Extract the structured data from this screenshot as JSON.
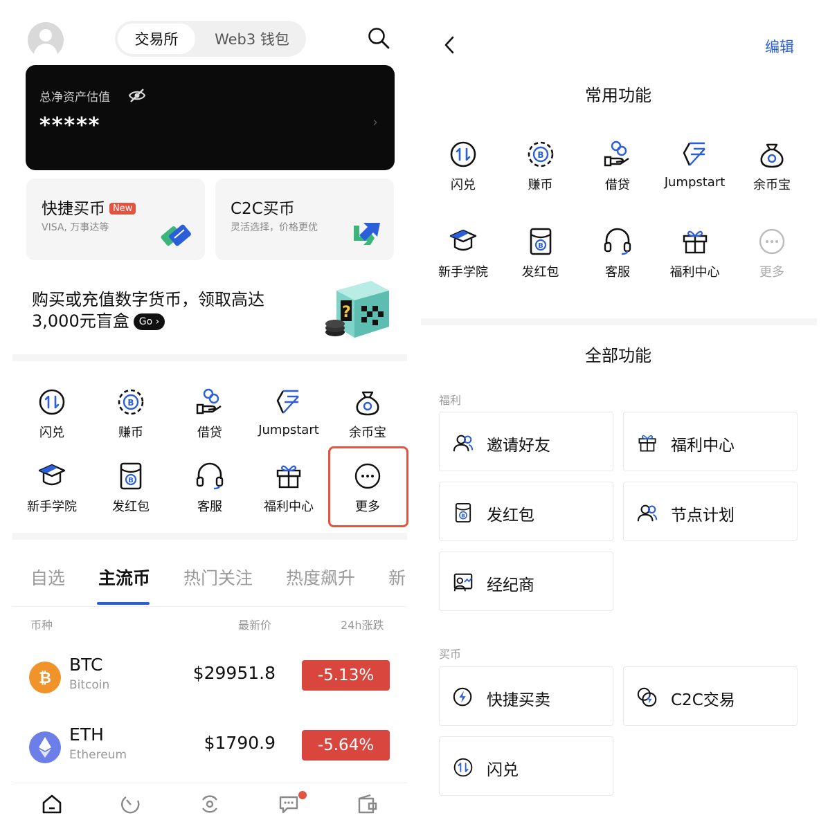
{
  "left": {
    "segment": {
      "active": "交易所",
      "inactive": "Web3 钱包"
    },
    "icons": {
      "avatar": "avatar-icon",
      "search": "search-icon"
    },
    "asset": {
      "label": "总净资产估值",
      "value": "*****",
      "eye_icon": "eye-off-icon"
    },
    "buy_cards": [
      {
        "title": "快捷买币",
        "badge": "New",
        "subtitle": "VISA, 万事达等",
        "icon": "cards-icon"
      },
      {
        "title": "C2C买币",
        "subtitle": "灵活选择，价格更优",
        "icon": "exchange-arrows-icon"
      }
    ],
    "promo": {
      "line1": "购买或充值数字货币，领取高达",
      "line2": "3,000元盲盒",
      "go": "Go"
    },
    "functions": [
      {
        "name": "闪兑",
        "icon": "swap-icon"
      },
      {
        "name": "赚币",
        "icon": "earn-coin-icon"
      },
      {
        "name": "借贷",
        "icon": "loan-icon"
      },
      {
        "name": "Jumpstart",
        "icon": "jumpstart-icon"
      },
      {
        "name": "余币宝",
        "icon": "money-bag-icon"
      },
      {
        "name": "新手学院",
        "icon": "graduation-cap-icon"
      },
      {
        "name": "发红包",
        "icon": "red-packet-icon"
      },
      {
        "name": "客服",
        "icon": "headset-icon"
      },
      {
        "name": "福利中心",
        "icon": "gift-icon"
      },
      {
        "name": "更多",
        "icon": "more-icon"
      }
    ],
    "market_tabs": [
      "自选",
      "主流币",
      "热门关注",
      "热度飙升",
      "新"
    ],
    "market_active": "主流币",
    "table_header": {
      "coin": "币种",
      "price": "最新价",
      "change": "24h涨跌"
    },
    "coins": [
      {
        "symbol": "BTC",
        "name": "Bitcoin",
        "price": "$29951.8",
        "change": "-5.13%",
        "color": "#f0932b"
      },
      {
        "symbol": "ETH",
        "name": "Ethereum",
        "price": "$1790.9",
        "change": "-5.64%",
        "color": "#6c7fe8"
      }
    ],
    "bottom_nav": [
      "home-icon",
      "markets-icon",
      "trade-icon",
      "messages-icon",
      "wallet-icon"
    ]
  },
  "right": {
    "edit": "编辑",
    "common_title": "常用功能",
    "common": [
      {
        "name": "闪兑",
        "icon": "swap-icon"
      },
      {
        "name": "赚币",
        "icon": "earn-coin-icon"
      },
      {
        "name": "借贷",
        "icon": "loan-icon"
      },
      {
        "name": "Jumpstart",
        "icon": "jumpstart-icon"
      },
      {
        "name": "余币宝",
        "icon": "money-bag-icon"
      },
      {
        "name": "新手学院",
        "icon": "graduation-cap-icon"
      },
      {
        "name": "发红包",
        "icon": "red-packet-icon"
      },
      {
        "name": "客服",
        "icon": "headset-icon"
      },
      {
        "name": "福利中心",
        "icon": "gift-icon"
      },
      {
        "name": "更多",
        "icon": "more-icon"
      }
    ],
    "all_title": "全部功能",
    "groups": [
      {
        "name": "福利",
        "items": [
          {
            "label": "邀请好友",
            "icon": "invite-friends-icon"
          },
          {
            "label": "福利中心",
            "icon": "gift-icon"
          },
          {
            "label": "发红包",
            "icon": "red-packet-icon"
          },
          {
            "label": "节点计划",
            "icon": "node-plan-icon"
          },
          {
            "label": "经纪商",
            "icon": "broker-icon"
          }
        ]
      },
      {
        "name": "买币",
        "items": [
          {
            "label": "快捷买卖",
            "icon": "quick-trade-icon"
          },
          {
            "label": "C2C交易",
            "icon": "c2c-icon"
          },
          {
            "label": "闪兑",
            "icon": "swap-icon"
          }
        ]
      }
    ]
  },
  "colors": {
    "accent_blue": "#2b5fd9",
    "down_red": "#d9463d",
    "badge_red": "#e3533f"
  }
}
